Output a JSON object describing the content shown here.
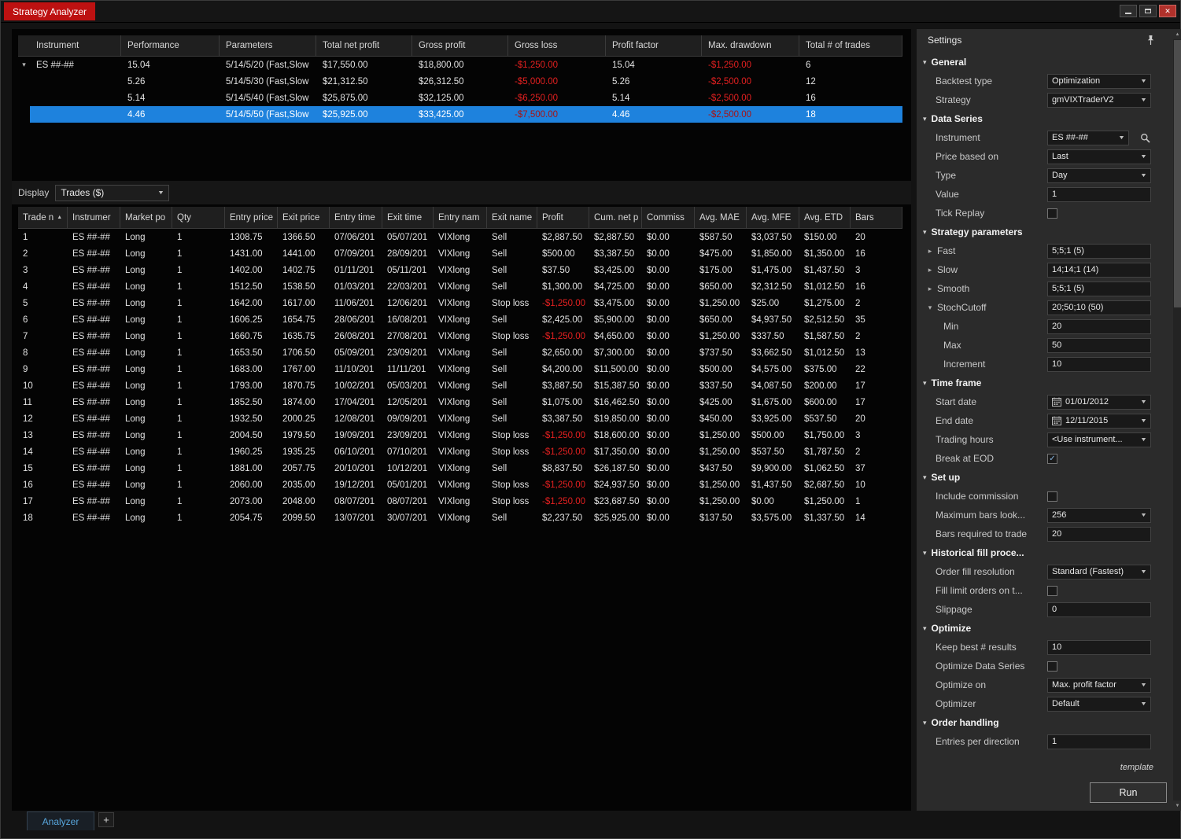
{
  "window": {
    "title": "Strategy Analyzer"
  },
  "results": {
    "columns": [
      "Instrument",
      "Performance",
      "Parameters",
      "Total net profit",
      "Gross profit",
      "Gross loss",
      "Profit factor",
      "Max. drawdown",
      "Total # of trades"
    ],
    "group_instrument": "ES ##-##",
    "selected_row": 3,
    "rows": [
      [
        "15.04",
        "5/14/5/20 (Fast,Slow",
        "$17,550.00",
        "$18,800.00",
        "-$1,250.00",
        "15.04",
        "-$1,250.00",
        "6"
      ],
      [
        "5.26",
        "5/14/5/30 (Fast,Slow",
        "$21,312.50",
        "$26,312.50",
        "-$5,000.00",
        "5.26",
        "-$2,500.00",
        "12"
      ],
      [
        "5.14",
        "5/14/5/40 (Fast,Slow",
        "$25,875.00",
        "$32,125.00",
        "-$6,250.00",
        "5.14",
        "-$2,500.00",
        "16"
      ],
      [
        "4.46",
        "5/14/5/50 (Fast,Slow",
        "$25,925.00",
        "$33,425.00",
        "-$7,500.00",
        "4.46",
        "-$2,500.00",
        "18"
      ]
    ]
  },
  "display": {
    "label": "Display",
    "value": "Trades ($)"
  },
  "trades": {
    "columns": [
      "Trade n",
      "Instrumer",
      "Market po",
      "Qty",
      "Entry price",
      "Exit price",
      "Entry time",
      "Exit time",
      "Entry nam",
      "Exit name",
      "Profit",
      "Cum. net p",
      "Commiss",
      "Avg. MAE",
      "Avg. MFE",
      "Avg. ETD",
      "Bars"
    ],
    "sort_column": 0,
    "rows": [
      [
        "1",
        "ES ##-##",
        "Long",
        "1",
        "1308.75",
        "1366.50",
        "07/06/201",
        "05/07/201",
        "VIXlong",
        "Sell",
        "$2,887.50",
        "$2,887.50",
        "$0.00",
        "$587.50",
        "$3,037.50",
        "$150.00",
        "20"
      ],
      [
        "2",
        "ES ##-##",
        "Long",
        "1",
        "1431.00",
        "1441.00",
        "07/09/201",
        "28/09/201",
        "VIXlong",
        "Sell",
        "$500.00",
        "$3,387.50",
        "$0.00",
        "$475.00",
        "$1,850.00",
        "$1,350.00",
        "16"
      ],
      [
        "3",
        "ES ##-##",
        "Long",
        "1",
        "1402.00",
        "1402.75",
        "01/11/201",
        "05/11/201",
        "VIXlong",
        "Sell",
        "$37.50",
        "$3,425.00",
        "$0.00",
        "$175.00",
        "$1,475.00",
        "$1,437.50",
        "3"
      ],
      [
        "4",
        "ES ##-##",
        "Long",
        "1",
        "1512.50",
        "1538.50",
        "01/03/201",
        "22/03/201",
        "VIXlong",
        "Sell",
        "$1,300.00",
        "$4,725.00",
        "$0.00",
        "$650.00",
        "$2,312.50",
        "$1,012.50",
        "16"
      ],
      [
        "5",
        "ES ##-##",
        "Long",
        "1",
        "1642.00",
        "1617.00",
        "11/06/201",
        "12/06/201",
        "VIXlong",
        "Stop loss",
        "-$1,250.00",
        "$3,475.00",
        "$0.00",
        "$1,250.00",
        "$25.00",
        "$1,275.00",
        "2"
      ],
      [
        "6",
        "ES ##-##",
        "Long",
        "1",
        "1606.25",
        "1654.75",
        "28/06/201",
        "16/08/201",
        "VIXlong",
        "Sell",
        "$2,425.00",
        "$5,900.00",
        "$0.00",
        "$650.00",
        "$4,937.50",
        "$2,512.50",
        "35"
      ],
      [
        "7",
        "ES ##-##",
        "Long",
        "1",
        "1660.75",
        "1635.75",
        "26/08/201",
        "27/08/201",
        "VIXlong",
        "Stop loss",
        "-$1,250.00",
        "$4,650.00",
        "$0.00",
        "$1,250.00",
        "$337.50",
        "$1,587.50",
        "2"
      ],
      [
        "8",
        "ES ##-##",
        "Long",
        "1",
        "1653.50",
        "1706.50",
        "05/09/201",
        "23/09/201",
        "VIXlong",
        "Sell",
        "$2,650.00",
        "$7,300.00",
        "$0.00",
        "$737.50",
        "$3,662.50",
        "$1,012.50",
        "13"
      ],
      [
        "9",
        "ES ##-##",
        "Long",
        "1",
        "1683.00",
        "1767.00",
        "11/10/201",
        "11/11/201",
        "VIXlong",
        "Sell",
        "$4,200.00",
        "$11,500.00",
        "$0.00",
        "$500.00",
        "$4,575.00",
        "$375.00",
        "22"
      ],
      [
        "10",
        "ES ##-##",
        "Long",
        "1",
        "1793.00",
        "1870.75",
        "10/02/201",
        "05/03/201",
        "VIXlong",
        "Sell",
        "$3,887.50",
        "$15,387.50",
        "$0.00",
        "$337.50",
        "$4,087.50",
        "$200.00",
        "17"
      ],
      [
        "11",
        "ES ##-##",
        "Long",
        "1",
        "1852.50",
        "1874.00",
        "17/04/201",
        "12/05/201",
        "VIXlong",
        "Sell",
        "$1,075.00",
        "$16,462.50",
        "$0.00",
        "$425.00",
        "$1,675.00",
        "$600.00",
        "17"
      ],
      [
        "12",
        "ES ##-##",
        "Long",
        "1",
        "1932.50",
        "2000.25",
        "12/08/201",
        "09/09/201",
        "VIXlong",
        "Sell",
        "$3,387.50",
        "$19,850.00",
        "$0.00",
        "$450.00",
        "$3,925.00",
        "$537.50",
        "20"
      ],
      [
        "13",
        "ES ##-##",
        "Long",
        "1",
        "2004.50",
        "1979.50",
        "19/09/201",
        "23/09/201",
        "VIXlong",
        "Stop loss",
        "-$1,250.00",
        "$18,600.00",
        "$0.00",
        "$1,250.00",
        "$500.00",
        "$1,750.00",
        "3"
      ],
      [
        "14",
        "ES ##-##",
        "Long",
        "1",
        "1960.25",
        "1935.25",
        "06/10/201",
        "07/10/201",
        "VIXlong",
        "Stop loss",
        "-$1,250.00",
        "$17,350.00",
        "$0.00",
        "$1,250.00",
        "$537.50",
        "$1,787.50",
        "2"
      ],
      [
        "15",
        "ES ##-##",
        "Long",
        "1",
        "1881.00",
        "2057.75",
        "20/10/201",
        "10/12/201",
        "VIXlong",
        "Sell",
        "$8,837.50",
        "$26,187.50",
        "$0.00",
        "$437.50",
        "$9,900.00",
        "$1,062.50",
        "37"
      ],
      [
        "16",
        "ES ##-##",
        "Long",
        "1",
        "2060.00",
        "2035.00",
        "19/12/201",
        "05/01/201",
        "VIXlong",
        "Stop loss",
        "-$1,250.00",
        "$24,937.50",
        "$0.00",
        "$1,250.00",
        "$1,437.50",
        "$2,687.50",
        "10"
      ],
      [
        "17",
        "ES ##-##",
        "Long",
        "1",
        "2073.00",
        "2048.00",
        "08/07/201",
        "08/07/201",
        "VIXlong",
        "Stop loss",
        "-$1,250.00",
        "$23,687.50",
        "$0.00",
        "$1,250.00",
        "$0.00",
        "$1,250.00",
        "1"
      ],
      [
        "18",
        "ES ##-##",
        "Long",
        "1",
        "2054.75",
        "2099.50",
        "13/07/201",
        "30/07/201",
        "VIXlong",
        "Sell",
        "$2,237.50",
        "$25,925.00",
        "$0.00",
        "$137.50",
        "$3,575.00",
        "$1,337.50",
        "14"
      ]
    ]
  },
  "settings": {
    "title": "Settings",
    "template_link": "template",
    "run_button": "Run",
    "sections": [
      {
        "label": "General",
        "items": [
          {
            "label": "Backtest type",
            "type": "select",
            "value": "Optimization"
          },
          {
            "label": "Strategy",
            "type": "select",
            "value": "gmVIXTraderV2"
          }
        ]
      },
      {
        "label": "Data Series",
        "items": [
          {
            "label": "Instrument",
            "type": "select-search",
            "value": "ES ##-##"
          },
          {
            "label": "Price based on",
            "type": "select",
            "value": "Last"
          },
          {
            "label": "Type",
            "type": "select",
            "value": "Day"
          },
          {
            "label": "Value",
            "type": "input",
            "value": "1"
          },
          {
            "label": "Tick Replay",
            "type": "checkbox",
            "checked": false
          }
        ]
      },
      {
        "label": "Strategy parameters",
        "items": [
          {
            "label": "Fast",
            "type": "input",
            "value": "5;5;1 (5)",
            "expandable": true,
            "expanded": false
          },
          {
            "label": "Slow",
            "type": "input",
            "value": "14;14;1 (14)",
            "expandable": true,
            "expanded": false
          },
          {
            "label": "Smooth",
            "type": "input",
            "value": "5;5;1 (5)",
            "expandable": true,
            "expanded": false
          },
          {
            "label": "StochCutoff",
            "type": "input",
            "value": "20;50;10 (50)",
            "expandable": true,
            "expanded": true
          },
          {
            "label": "Min",
            "type": "input",
            "value": "20",
            "indent": true
          },
          {
            "label": "Max",
            "type": "input",
            "value": "50",
            "indent": true
          },
          {
            "label": "Increment",
            "type": "input",
            "value": "10",
            "indent": true
          }
        ]
      },
      {
        "label": "Time frame",
        "items": [
          {
            "label": "Start date",
            "type": "date",
            "value": "01/01/2012"
          },
          {
            "label": "End date",
            "type": "date",
            "value": "12/11/2015"
          },
          {
            "label": "Trading hours",
            "type": "select",
            "value": "<Use instrument..."
          },
          {
            "label": "Break at EOD",
            "type": "checkbox",
            "checked": true
          }
        ]
      },
      {
        "label": "Set up",
        "items": [
          {
            "label": "Include commission",
            "type": "checkbox",
            "checked": false
          },
          {
            "label": "Maximum bars look...",
            "type": "select",
            "value": "256"
          },
          {
            "label": "Bars required to trade",
            "type": "input",
            "value": "20"
          }
        ]
      },
      {
        "label": "Historical fill proce...",
        "items": [
          {
            "label": "Order fill resolution",
            "type": "select",
            "value": "Standard (Fastest)"
          },
          {
            "label": "Fill limit orders on t...",
            "type": "checkbox",
            "checked": false
          },
          {
            "label": "Slippage",
            "type": "input",
            "value": "0"
          }
        ]
      },
      {
        "label": "Optimize",
        "items": [
          {
            "label": "Keep best # results",
            "type": "input",
            "value": "10"
          },
          {
            "label": "Optimize Data Series",
            "type": "checkbox",
            "checked": false
          },
          {
            "label": "Optimize on",
            "type": "select",
            "value": "Max. profit factor"
          },
          {
            "label": "Optimizer",
            "type": "select",
            "value": "Default"
          }
        ]
      },
      {
        "label": "Order handling",
        "items": [
          {
            "label": "Entries per direction",
            "type": "input",
            "value": "1"
          }
        ]
      }
    ]
  },
  "footer_tabs": {
    "analyzer": "Analyzer",
    "add_tab": "+"
  }
}
